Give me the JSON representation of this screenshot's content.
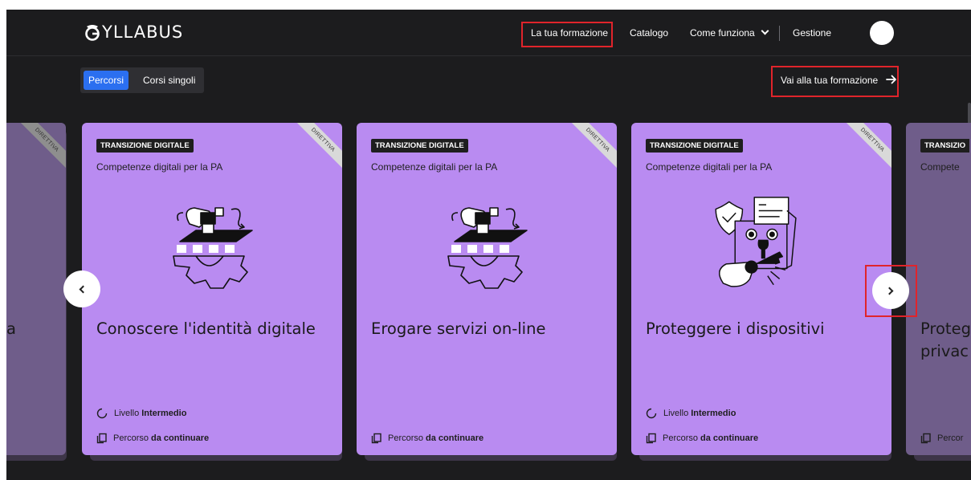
{
  "header": {
    "logo": "YLLABUS",
    "nav": {
      "training": "La tua formazione",
      "catalog": "Catalogo",
      "how_it_works": "Come funziona",
      "management": "Gestione"
    }
  },
  "toolbar": {
    "tabs": [
      "Percorsi",
      "Corsi singoli"
    ],
    "go_to_training": "Vai alla tua formazione"
  },
  "cards": [
    {
      "badge": "TRANSIZIONE DIGITALE",
      "subtitle": "Competenze digitali per la PA",
      "title": "Conoscere l'identità digitale",
      "ribbon": "DIRETTIVA",
      "level_label": "Livello",
      "level_value": "Intermedio",
      "status_label": "Percorso",
      "status_value": "da continuare",
      "illustration": "hand-gear-icon"
    },
    {
      "badge": "TRANSIZIONE DIGITALE",
      "subtitle": "Competenze digitali per la PA",
      "title": "Erogare servizi on-line",
      "ribbon": "DIRETTIVA",
      "status_label": "Percorso",
      "status_value": "da continuare",
      "illustration": "hand-gear-icon"
    },
    {
      "badge": "TRANSIZIONE DIGITALE",
      "subtitle": "Competenze digitali per la PA",
      "title": "Proteggere i dispositivi",
      "ribbon": "DIRETTIVA",
      "level_label": "Livello",
      "level_value": "Intermedio",
      "status_label": "Percorso",
      "status_value": "da continuare",
      "illustration": "shield-lock-key-icon"
    }
  ],
  "partial_left": {
    "ribbon": "DIRETTIVA",
    "title_fragment": "a"
  },
  "partial_right": {
    "badge": "TRANSIZIO",
    "subtitle": "Compete",
    "title_line1": "Proteg",
    "title_line2": "privac",
    "status_label": "Percor"
  },
  "colors": {
    "background": "#1c1c1e",
    "card": "#b98bf1",
    "accent": "#2b6ff0",
    "highlight_box": "#e0242b"
  }
}
